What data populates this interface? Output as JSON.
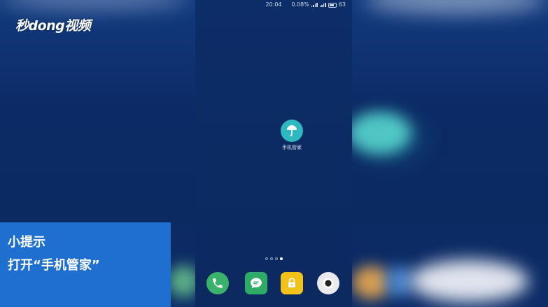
{
  "watermark": {
    "logo_text": "秒dong视频"
  },
  "status_bar": {
    "time": "20:04",
    "network_speed": "0.08%",
    "battery_level": "63"
  },
  "home_screen": {
    "app": {
      "label": "手机管家",
      "icon": "umbrella-icon",
      "color": "#2fb8c0"
    },
    "page_indicator": {
      "pages": 4,
      "active_index": 3
    },
    "dock": [
      {
        "name": "phone",
        "icon": "phone-icon",
        "color": "#3bb26b"
      },
      {
        "name": "messages",
        "icon": "message-icon",
        "color": "#2eab67"
      },
      {
        "name": "lock",
        "icon": "lock-icon",
        "color": "#f2c21b"
      },
      {
        "name": "camera",
        "icon": "camera-icon",
        "color": "#e9e9ee"
      }
    ]
  },
  "tip_panel": {
    "title": "小提示",
    "text": "打开“手机管家”",
    "color": "#1f6fd0"
  }
}
